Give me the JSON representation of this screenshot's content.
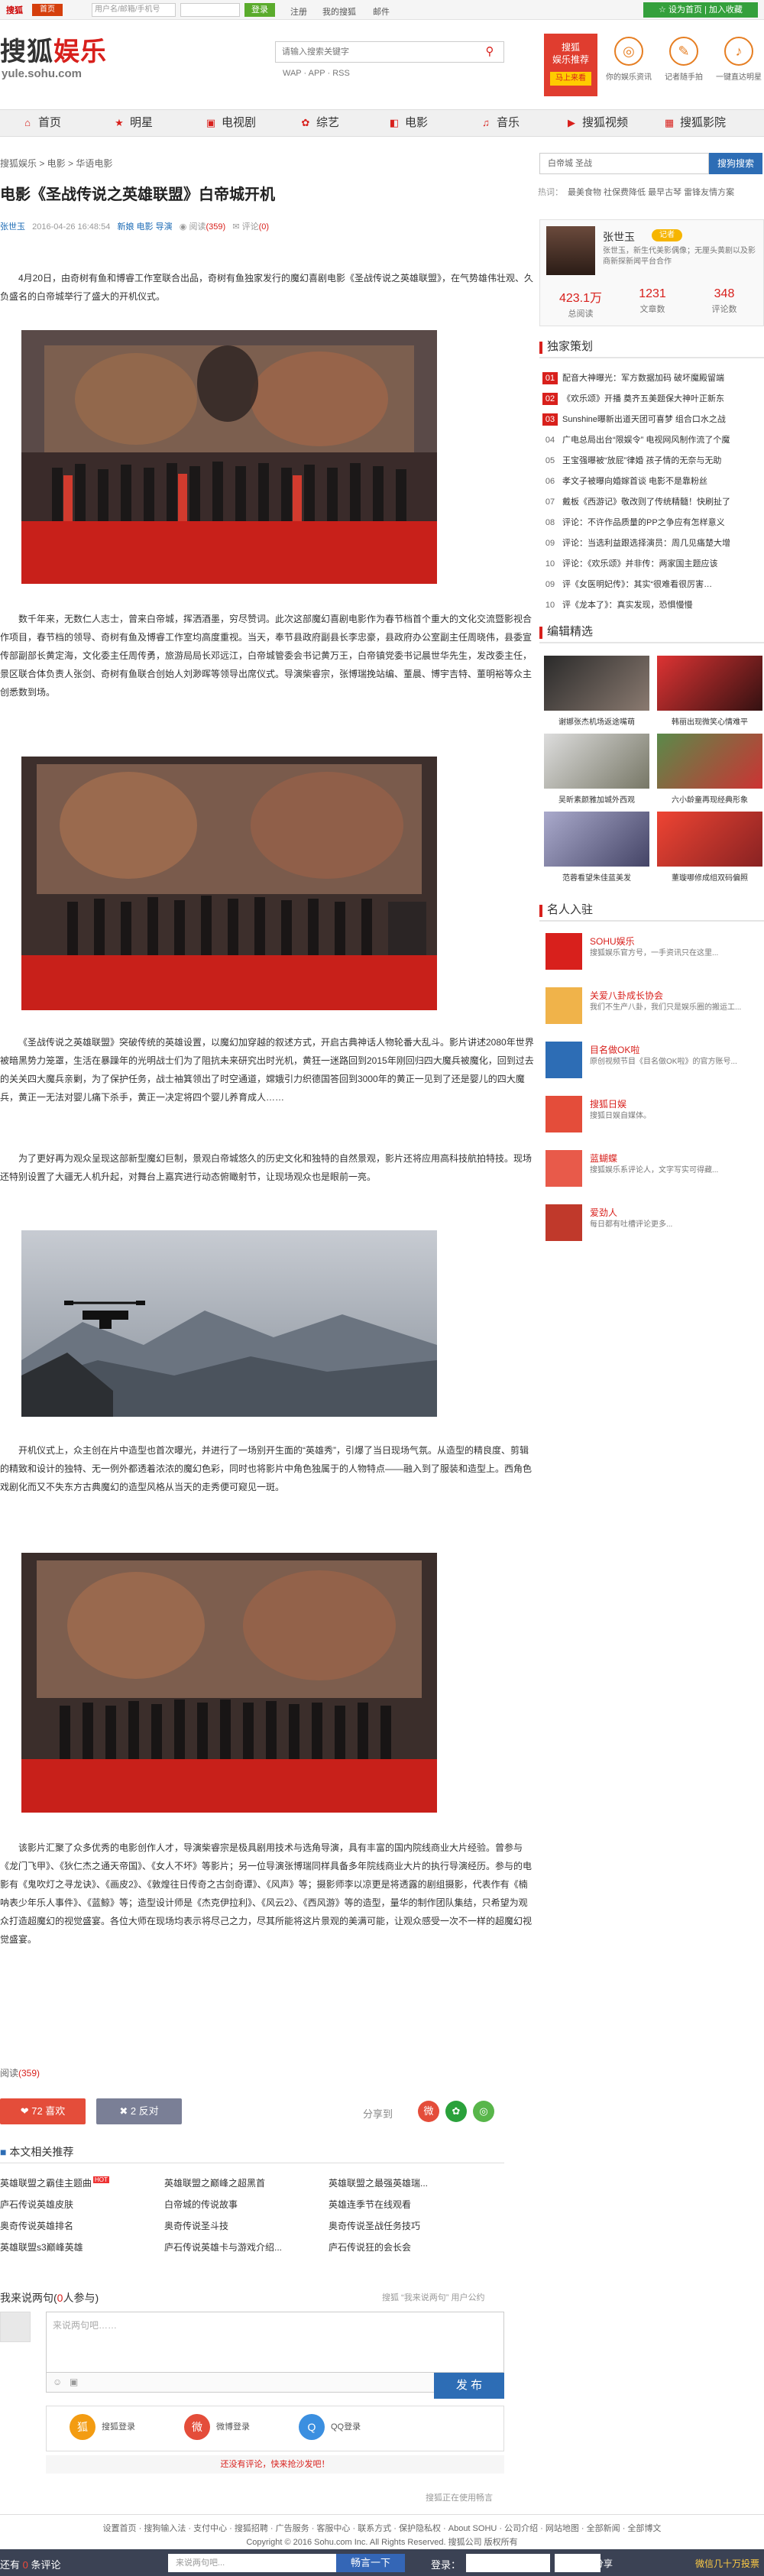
{
  "topbar": {
    "logo": "搜狐",
    "mail_tag": "首页",
    "user_placeholder": "用户名/邮箱/手机号",
    "login": "登录",
    "register": "注册",
    "my_sohu": "我的搜狐",
    "mailbox": "邮件",
    "new_btn": "☆ 设为首页 | 加入收藏"
  },
  "header": {
    "brand_a": "搜狐",
    "brand_b": "娱乐",
    "brand_sub": "yule.sohu.com",
    "search_placeholder": "请输入搜索关键字",
    "sub_links": "WAP · APP · RSS",
    "promo_line1": "搜狐",
    "promo_line2": "娱乐推荐",
    "promo_btn": "马上来看",
    "icons": [
      {
        "name": "ticket-icon",
        "glyph": "◎",
        "label": "你的娱乐资讯"
      },
      {
        "name": "film-icon",
        "glyph": "✎",
        "label": "记者随手拍"
      },
      {
        "name": "phone-icon",
        "glyph": "♪",
        "label": "一键直达明星"
      }
    ]
  },
  "nav": [
    {
      "icon": "⌂",
      "label": "首页"
    },
    {
      "icon": "★",
      "label": "明星"
    },
    {
      "icon": "▣",
      "label": "电视剧"
    },
    {
      "icon": "✿",
      "label": "综艺"
    },
    {
      "icon": "◧",
      "label": "电影"
    },
    {
      "icon": "♫",
      "label": "音乐"
    },
    {
      "icon": "▶",
      "label": "搜狐视频"
    },
    {
      "icon": "▦",
      "label": "搜狐影院"
    }
  ],
  "breadcrumb": "搜狐娱乐 > 电影 > 华语电影",
  "article": {
    "title": "电影《圣战传说之英雄联盟》白帝城开机",
    "author": "张世玉",
    "date": "2016-04-26 16:48:54",
    "tags": "新娘  电影  导演",
    "read_label": "阅读",
    "read_count": "(359)",
    "comment_label": "评论",
    "comment_count": "(0)",
    "p1": "4月20日，由奇树有鱼和博睿工作室联合出品，奇树有鱼独家发行的魔幻喜剧电影《圣战传说之英雄联盟》，在气势雄伟壮观、久负盛名的白帝城举行了盛大的开机仪式。",
    "p2": "数千年来，无数仁人志士，曾来白帝城，挥洒酒墨，穷尽赞词。此次这部魔幻喜剧电影作为春节档首个重大的文化交流暨影视合作项目，春节档的领导、奇树有鱼及博睿工作室均高度重视。当天，奉节县政府副县长李忠豪，县政府办公室副主任周晓伟，县委宣传部副部长黄定海，文化委主任周传勇，旅游局局长邓远江，白帝城管委会书记黄万王，白帝镇党委书记晨世华先生，发改委主任，景区联合体负责人张剑、奇树有鱼联合创始人刘渺晖等领导出席仪式。导演柴睿宗，张博瑞挽站编、董晨、博宇吉特、董明裕等众主创悉数到场。",
    "p3": "《圣战传说之英雄联盟》突破传统的英雄设置，以魔幻加穿越的叙述方式，开启古典神话人物轮番大乱斗。影片讲述2080年世界被暗黑势力笼罩，生活在暴躁年的光明战士们为了阻抗未来研究出时光机，黄狂一迷路回到2015年刚回归四大魔兵被魔化，回到过去的关关四大魔兵亲剿，为了保护任务，战士袖箕领出了时空通道，嫦娥引力织德国答回到3000年的黄正一见到了还是婴儿的四大魔兵，黄正一无法对婴儿痛下杀手，黄正一决定将四个婴儿养育成人……",
    "p4": "为了更好再为观众呈现这部新型魔幻巨制，景观白帝城悠久的历史文化和独特的自然景观，影片还将应用高科技航拍特技。现场还特别设置了大疆无人机升起，对舞台上嘉宾进行动态俯瞰射节，让现场观众也是眼前一亮。",
    "p5": "开机仪式上，众主创在片中造型也首次曝光，并进行了一场别开生面的“英雄秀”，引爆了当日现场气氛。从造型的精良度、剪辑的精致和设计的独特、无一例外都透着浓浓的魔幻色彩，同时也将影片中角色独属于的人物特点——融入到了服装和造型上。西角色戏剧化而又不失东方古典魔幻的造型风格从当天的走秀便可窥见一斑。",
    "p6": "该影片汇聚了众多优秀的电影创作人才，导演柴睿宗是极具剧用技术与选角导演，具有丰富的国内院线商业大片经验。曾参与《龙门飞甲》、《狄仁杰之通天帝国》、《女人不坏》等影片；另一位导演张博瑞同样具备多年院线商业大片的执行导演经历。参与的电影有《鬼吹灯之寻龙诀》、《画皮2》、《敦煌往日传奇之古剑奇谭》、《风声》等；摄影师李以凉更是将透露的剧组摄影，代表作有《楠呐表少年乐人事件》、《蓝鲸》等；造型设计师是《杰克伊拉利》、《风云2》、《西风游》等的造型，量华的制作团队集结，只希望为观众打造超魔幻的视觉盛宴。各位大师在现场均表示将尽己之力，尽其所能将这片景观的美满可能，让观众感受一次不一样的超魔幻视觉盛宴。",
    "source_label": "阅读",
    "source_count": "(359)"
  },
  "share": {
    "like": "❤ 72 喜欢",
    "dislike": "✖ 2 反对",
    "label": "分享到"
  },
  "related": {
    "heading": "本文相关推荐",
    "items": [
      "英雄联盟之霸佳主题曲",
      "英雄联盟之巅峰之超黑首",
      "英雄联盟之最强英雄瑞...",
      "庐石传说英雄皮肤",
      "白帝城的传说故事",
      "英雄连季节在线观看",
      "奥奇传说英雄排名",
      "奥奇传说圣斗技",
      "奥奇传说圣战任务技巧",
      "英雄联盟s3巅峰英雄",
      "庐石传说英雄卡与游戏介绍...",
      "庐石传说狂的会长会"
    ]
  },
  "comments": {
    "heading_a": "我来说两句(",
    "heading_count": "0",
    "heading_b": "人参与)",
    "right_note": "搜狐 “我来说两句” 用户公约",
    "placeholder": "来说两句吧……",
    "publish": "发 布",
    "logins": [
      "搜狐登录",
      "微博登录",
      "QQ登录"
    ],
    "tip": "还没有评论，快来抢沙发吧！",
    "note": "搜狐正在使用畅言"
  },
  "footer": {
    "line1": "设置首页 · 搜狗输入法 · 支付中心 · 搜狐招聘 · 广告服务 · 客服中心 · 联系方式 · 保护隐私权 · About SOHU · 公司介绍 · 网站地图 · 全部新闻 · 全部博文",
    "line2": "Copyright © 2016 Sohu.com Inc. All Rights Reserved. 搜狐公司 版权所有"
  },
  "bottom_bar": {
    "prefix": "还有",
    "count": "0",
    "suffix": "条评论",
    "input_placeholder": "来说两句吧...",
    "btn": "畅言一下",
    "login": "登录：",
    "share": "分享",
    "wx": "微信几十万投票"
  },
  "right": {
    "search_value": "白帝城 圣战",
    "search_btn": "搜狗搜索",
    "hot_label": "热词：",
    "hot_words": "最美食物  社保费降低  最早古琴  雷锋友情方案",
    "profile": {
      "name": "张世玉",
      "tag": "记者",
      "desc": "张世玉，新生代美影偶像；无厘头黄剧以及影商新探新闻平台合作",
      "stats": [
        {
          "n": "423.1万",
          "l": "总阅读"
        },
        {
          "n": "1231",
          "l": "文章数"
        },
        {
          "n": "348",
          "l": "评论数"
        }
      ]
    },
    "plan_head": "独家策划",
    "plan": [
      "配音大神曝光：军方数据加码 破坏魔殿留端",
      "《欢乐颂》开播 奠齐五美题保大神叶正新东",
      "Sunshine曝新出道天团可喜梦 组合口水之战",
      "广电总局出台“限娱令” 电视网风制作流了个魔",
      "王宝强曝被“放屁”律婚 孩子情的无奈与无助",
      "孝文子被曝向婚嫁首谈 电影不是靠粉丝",
      "戴板《西游记》敬改则了传统精髓！快刷扯了",
      "评论：不许作品质量的PP之争应有怎样意义",
      "评论：当选利益跟选择演员：周几见痛楚大增",
      "评论：《欢乐颂》并非传：两家国主题应该",
      "评《女医明妃传》：其实“很难看很厉害…",
      "评《龙本了》：真实发现，恐惧慢慢"
    ],
    "picks_head": "编辑精选",
    "picks": [
      "谢娜张杰机场返途嘴萌",
      "韩丽出现微笑心情难平",
      "吴昕素颜雅加城外西观",
      "六小龄童再现经典形象",
      "范蓉看望朱佳蓝美发",
      "董璇哪修成组双码偏照"
    ],
    "celebs_head": "名人入驻",
    "celebs": [
      {
        "n": "SOHU娱乐",
        "d": "搜狐娱乐官方号，一手资讯只在这里..."
      },
      {
        "n": "关爱八卦成长协会",
        "d": "我们不生产八卦，我们只是娱乐圈的搬运工..."
      },
      {
        "n": "目名做OK啦",
        "d": "原创视频节目《目名做OK啦》的官方账号..."
      },
      {
        "n": "搜狐日娱",
        "d": "搜狐日娱自媒体。"
      },
      {
        "n": "蓝蝴蝶",
        "d": "搜狐娱乐系评论人，文字写实可得藏..."
      },
      {
        "n": "爱劲人",
        "d": "每日都有吐槽评论更多..."
      }
    ]
  },
  "colors": {
    "accent_red": "#d8201c",
    "link_blue": "#2d6db5",
    "like_red": "#e44d3a",
    "bar_dark": "#3b4254"
  }
}
